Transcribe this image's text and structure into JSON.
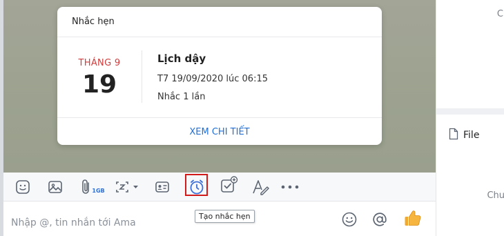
{
  "reminder": {
    "header": "Nhắc hẹn",
    "month": "THÁNG 9",
    "day": "19",
    "title": "Lịch dậy",
    "datetime": "T7 19/09/2020 lúc 06:15",
    "repeat": "Nhắc 1 lần",
    "view_details": "XEM CHI TIẾT"
  },
  "toolbar": {
    "items": [
      "sticker-icon",
      "image-icon",
      "attachment-icon",
      "screenshot-icon",
      "contact-card-icon",
      "reminder-clock-icon",
      "todo-icon",
      "text-format-icon",
      "more-icon"
    ],
    "attachment_badge": "1GB",
    "tooltip": "Tạo nhắc hẹn",
    "highlight_color": "#d11a1a"
  },
  "input": {
    "placeholder": "Nhập @, tin nhắn tới Ama"
  },
  "right_panel": {
    "top_text": "C",
    "file_label": "File",
    "bottom_text": "Chu"
  },
  "colors": {
    "accent": "#1f6fd6",
    "month": "#d23b3b",
    "thumb": "#f0a92e"
  }
}
